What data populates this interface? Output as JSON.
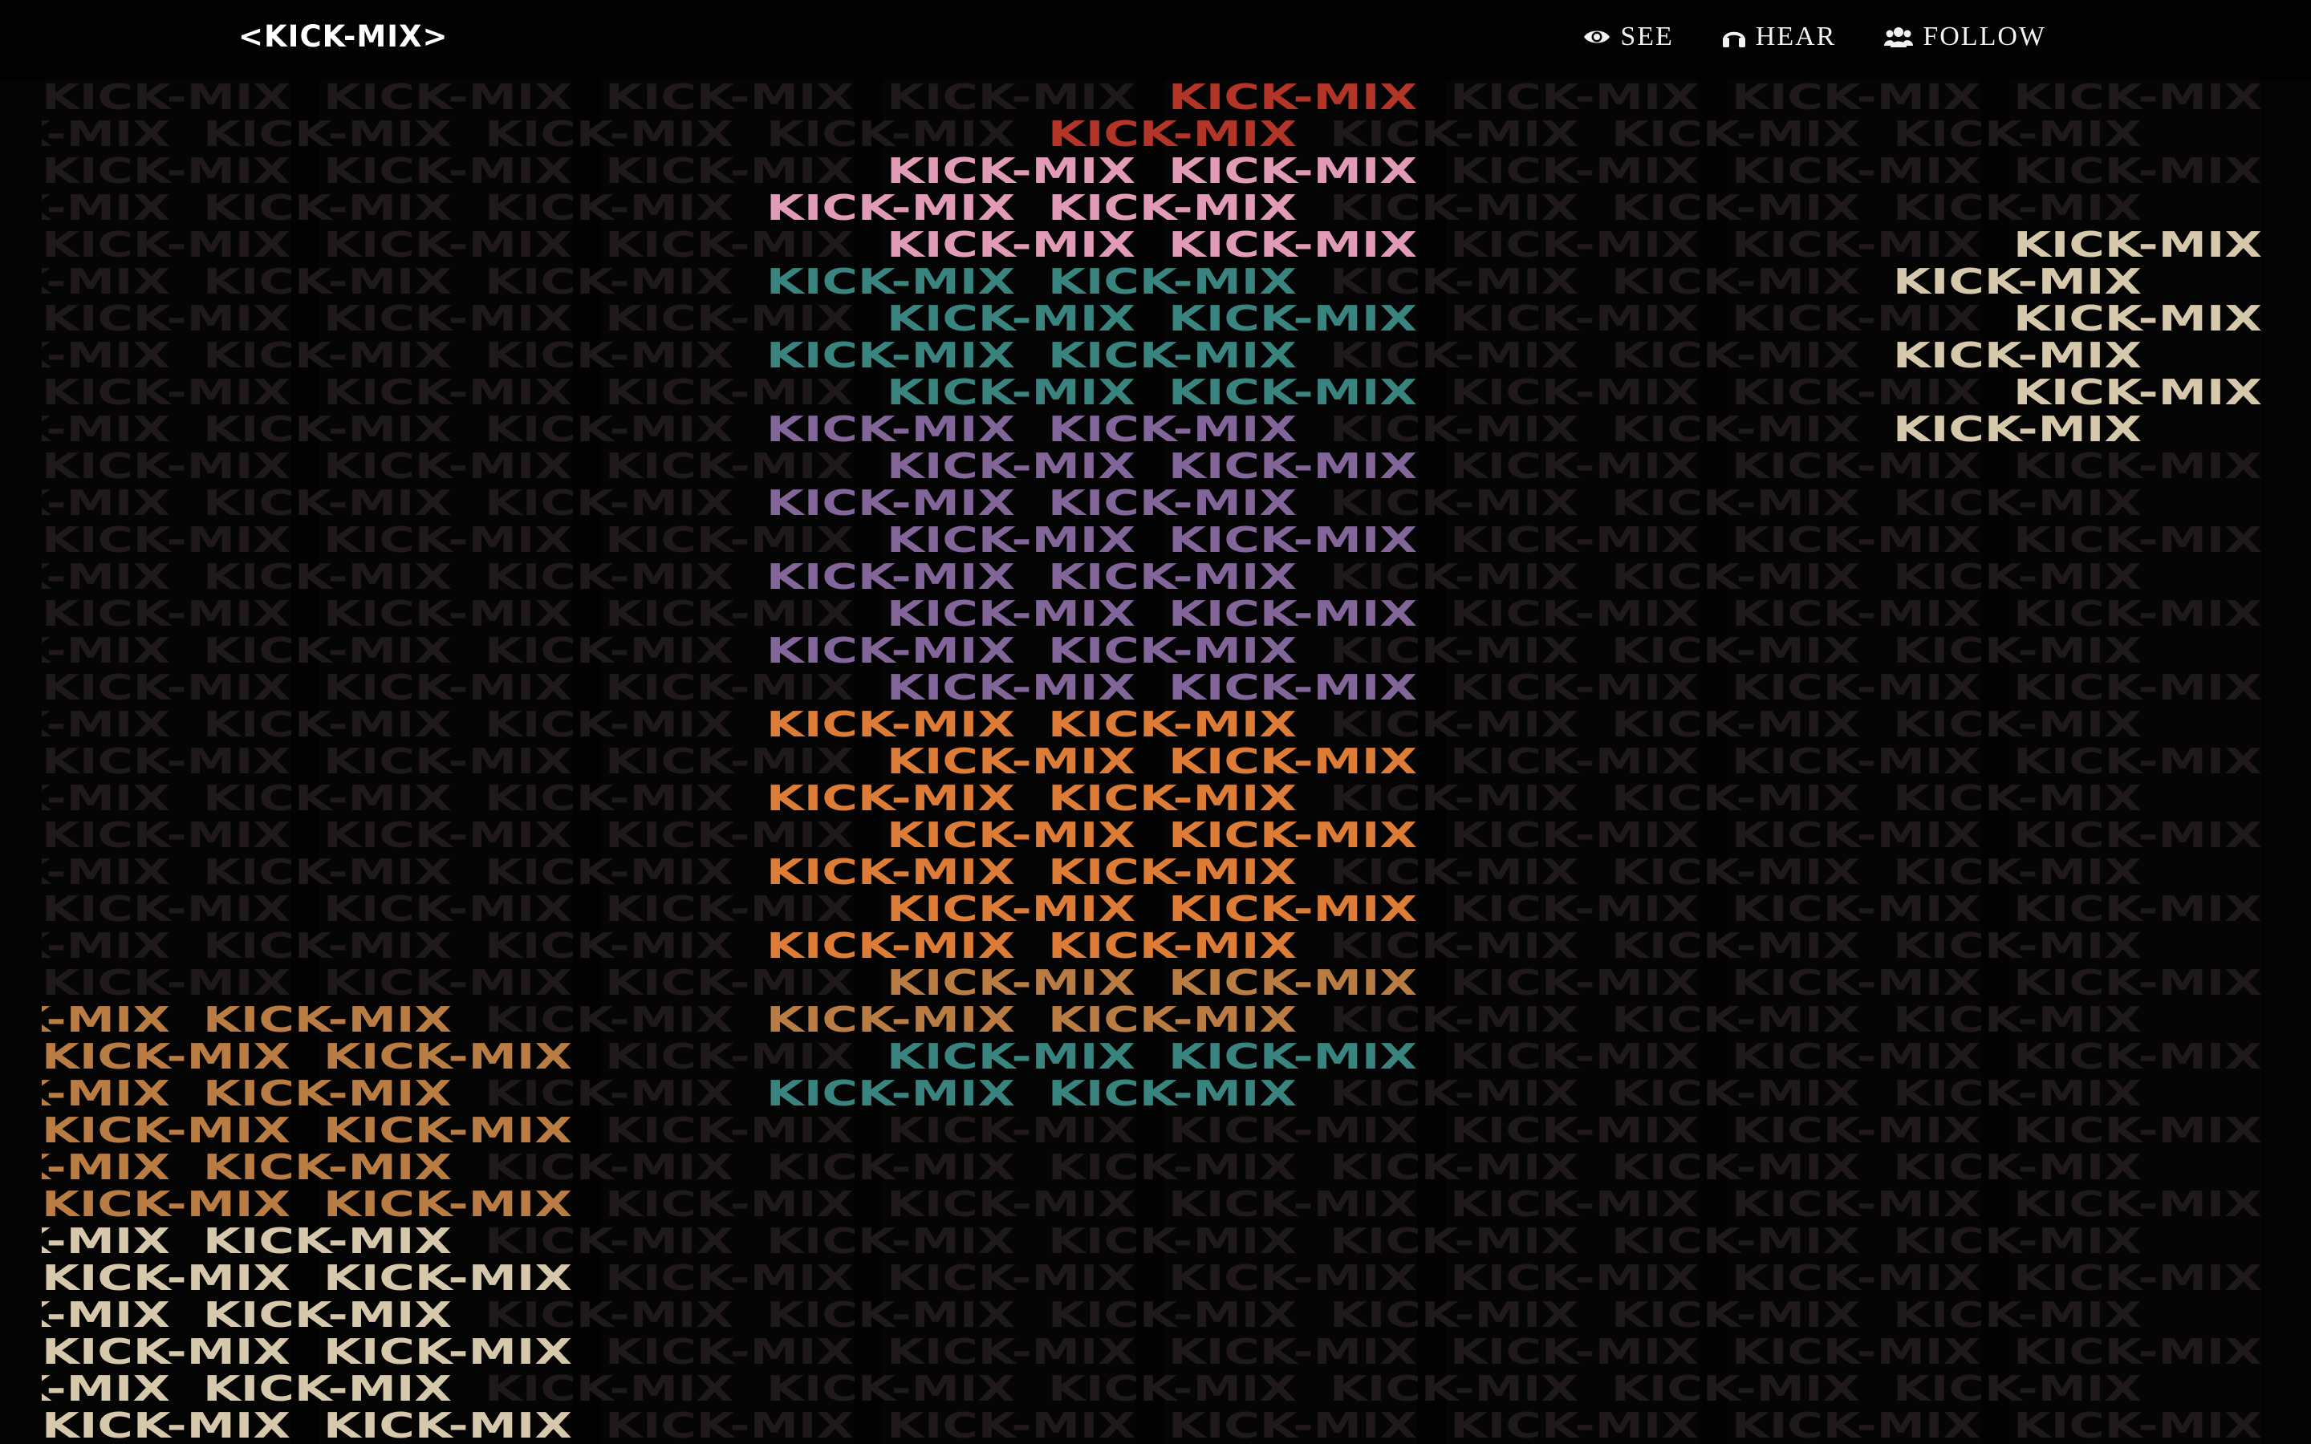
{
  "header": {
    "brand": "<KICK-MIX>",
    "nav": [
      {
        "label": "SEE",
        "icon": "eye-icon"
      },
      {
        "label": "HEAR",
        "icon": "headphones-icon"
      },
      {
        "label": "FOLLOW",
        "icon": "group-icon"
      }
    ]
  },
  "mosaic": {
    "pattern_text": "KICK-MIX",
    "colors": {
      "background": "#040404",
      "dim_text": "#1f1a19",
      "pink": "#f4a8c6",
      "purple": "#8d6fa6",
      "teal": "#3f8f8a",
      "orange": "#f0873c",
      "amber": "#c9884a",
      "cream": "#e8d9b8",
      "red": "#c23a2a"
    }
  }
}
